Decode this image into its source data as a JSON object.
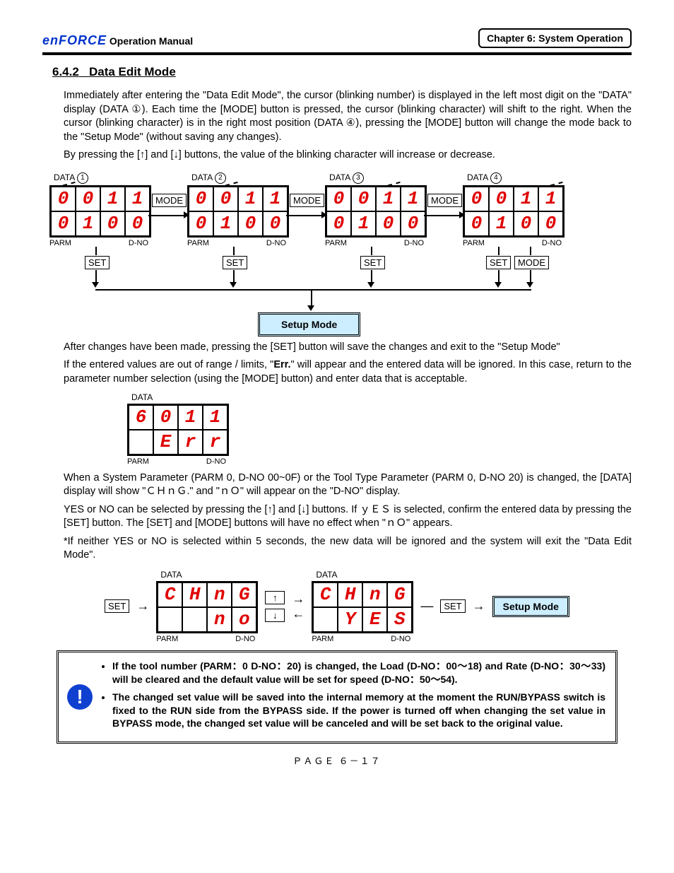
{
  "header": {
    "brand": "enFORCE",
    "manual": "Operation Manual",
    "chapter": "Chapter 6: System Operation"
  },
  "section": {
    "number": "6.4.2",
    "title": "Data Edit Mode"
  },
  "para1": "Immediately after entering the \"Data Edit Mode\", the cursor (blinking number) is displayed in the left most digit on the \"DATA\" display (DATA ①). Each time the [MODE] button is pressed, the cursor (blinking character) will shift to the right. When the cursor (blinking character) is in the right most position (DATA ④), pressing the [MODE] button will change the mode back to the \"Setup Mode\" (without saving any changes).",
  "para2": "By pressing the [↑] and [↓] buttons, the value of the blinking character will increase or decrease.",
  "diagram1": {
    "data_label": "DATA",
    "parm_label": "PARM",
    "dno_label": "D-NO",
    "mode_btn": "MODE",
    "set_btn": "SET",
    "setup_mode": "Setup Mode",
    "displays": [
      {
        "num": "1",
        "top": [
          "0",
          "0",
          "1",
          "1"
        ],
        "bottom": [
          "0",
          "1",
          "0",
          "0"
        ],
        "blink": 0
      },
      {
        "num": "2",
        "top": [
          "0",
          "0",
          "1",
          "1"
        ],
        "bottom": [
          "0",
          "1",
          "0",
          "0"
        ],
        "blink": 1
      },
      {
        "num": "3",
        "top": [
          "0",
          "0",
          "1",
          "1"
        ],
        "bottom": [
          "0",
          "1",
          "0",
          "0"
        ],
        "blink": 2
      },
      {
        "num": "4",
        "top": [
          "0",
          "0",
          "1",
          "1"
        ],
        "bottom": [
          "0",
          "1",
          "0",
          "0"
        ],
        "blink": 3
      }
    ]
  },
  "para3": "After changes have been made, pressing the [SET] button will save the changes and exit to the \"Setup Mode\"",
  "para4a": "If the entered values are out of range / limits, \"",
  "para4b": "Err.",
  "para4c": "\" will appear and the entered data will be ignored. In this case, return to the parameter number selection (using the [MODE] button) and enter data that is acceptable.",
  "diagram2": {
    "top": [
      "6",
      "0",
      "1",
      "1"
    ],
    "bottom": [
      " ",
      "E",
      "r",
      "r"
    ]
  },
  "para5": "When a System Parameter (PARM 0, D-NO 00~0F) or the Tool Type Parameter (PARM 0, D-NO 20) is changed, the [DATA] display will show \"ＣＨｎＧ.\" and \"ｎＯ\" will appear on the \"D-NO\" display.",
  "para6": "YES or NO can be selected by pressing the [↑] and [↓] buttons. If ｙＥＳ is selected, confirm the entered data by pressing the [SET] button. The [SET] and [MODE] buttons will have no effect when \"ｎＯ\" appears.",
  "para7": "*If neither YES or NO is selected within 5 seconds, the new data will be ignored and the system will exit the \"Data Edit Mode\".",
  "diagram3": {
    "left": {
      "top": [
        "C",
        "H",
        "n",
        "G"
      ],
      "bottom": [
        " ",
        " ",
        "n",
        "o"
      ]
    },
    "right": {
      "top": [
        "C",
        "H",
        "n",
        "G"
      ],
      "bottom": [
        " ",
        "Y",
        "E",
        "S"
      ]
    },
    "up": "↑",
    "down": "↓",
    "set": "SET",
    "setup": "Setup Mode"
  },
  "warn": {
    "b1": "If the tool number (PARM：0 D-NO：20) is changed, the Load (D-NO：00～18) and Rate (D-NO：30～33) will be cleared and the default value will be set for speed (D-NO：50～54).",
    "b2": "The changed set value will be saved into the internal memory at the moment the RUN/BYPASS switch is fixed to the RUN side from the BYPASS side. If the power is turned off when changing the set value in BYPASS mode, the changed set value will be canceled and will be set back to the original value."
  },
  "footer": "ＰＡＧＥ ６－１７"
}
